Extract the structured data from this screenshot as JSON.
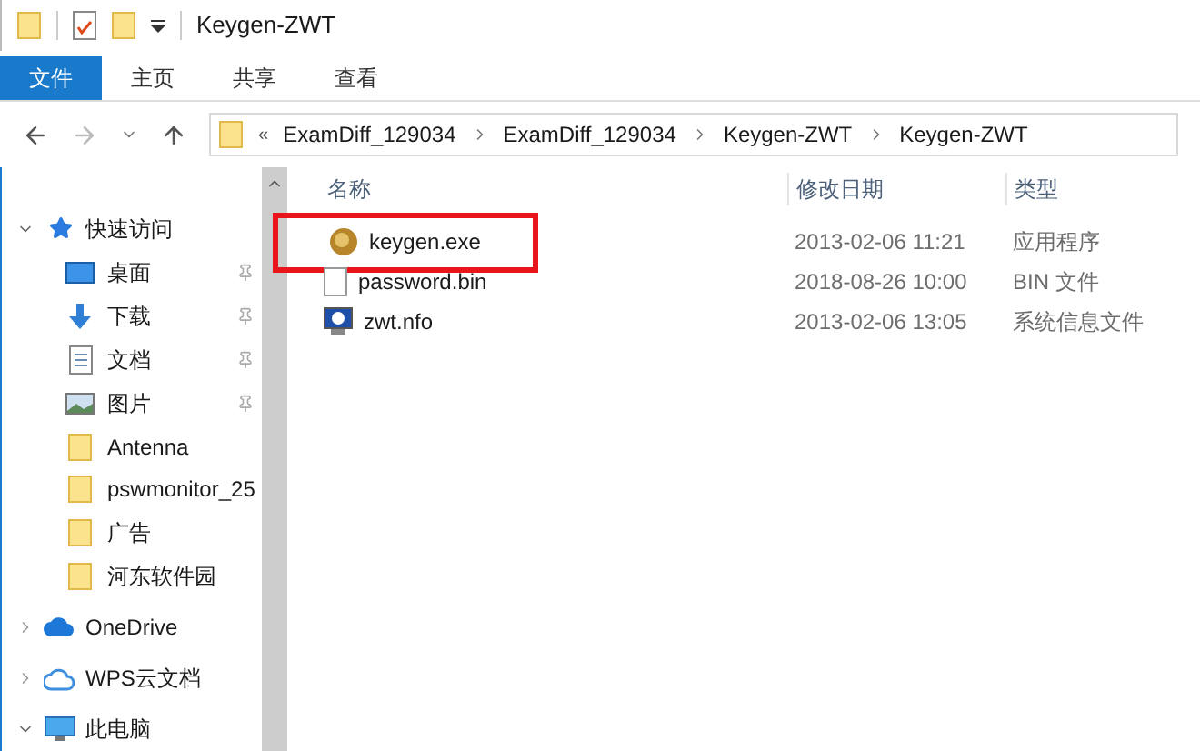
{
  "window": {
    "title": "Keygen-ZWT"
  },
  "ribbon_tabs": [
    {
      "label": "文件",
      "selected": true
    },
    {
      "label": "主页",
      "selected": false
    },
    {
      "label": "共享",
      "selected": false
    },
    {
      "label": "查看",
      "selected": false
    }
  ],
  "address_bar": {
    "overflow": "«",
    "path": [
      "ExamDiff_129034",
      "ExamDiff_129034",
      "Keygen-ZWT",
      "Keygen-ZWT"
    ]
  },
  "sidebar": {
    "items": [
      {
        "label": "快速访问",
        "kind": "star",
        "expanded": true
      },
      {
        "label": "桌面",
        "kind": "desktop",
        "pinned": true
      },
      {
        "label": "下载",
        "kind": "download",
        "pinned": true
      },
      {
        "label": "文档",
        "kind": "document",
        "pinned": true
      },
      {
        "label": "图片",
        "kind": "picture",
        "pinned": true
      },
      {
        "label": "Antenna",
        "kind": "folder",
        "pinned": false
      },
      {
        "label": "pswmonitor_25",
        "kind": "folder",
        "pinned": false
      },
      {
        "label": "广告",
        "kind": "folder",
        "pinned": false
      },
      {
        "label": "河东软件园",
        "kind": "folder",
        "pinned": false
      },
      {
        "label": "OneDrive",
        "kind": "cloud",
        "expanded": false
      },
      {
        "label": "WPS云文档",
        "kind": "outlinecloud",
        "expanded": false
      },
      {
        "label": "此电脑",
        "kind": "computer",
        "expanded": true
      }
    ]
  },
  "table": {
    "columns": [
      "名称",
      "修改日期",
      "类型"
    ],
    "rows": [
      {
        "name": "keygen.exe",
        "date": "2013-02-06 11:21",
        "type": "应用程序",
        "kind": "app",
        "highlighted": true
      },
      {
        "name": "password.bin",
        "date": "2018-08-26 10:00",
        "type": "BIN 文件",
        "kind": "blank",
        "highlighted": false
      },
      {
        "name": "zwt.nfo",
        "date": "2013-02-06 13:05",
        "type": "系统信息文件",
        "kind": "info",
        "highlighted": false
      }
    ]
  }
}
